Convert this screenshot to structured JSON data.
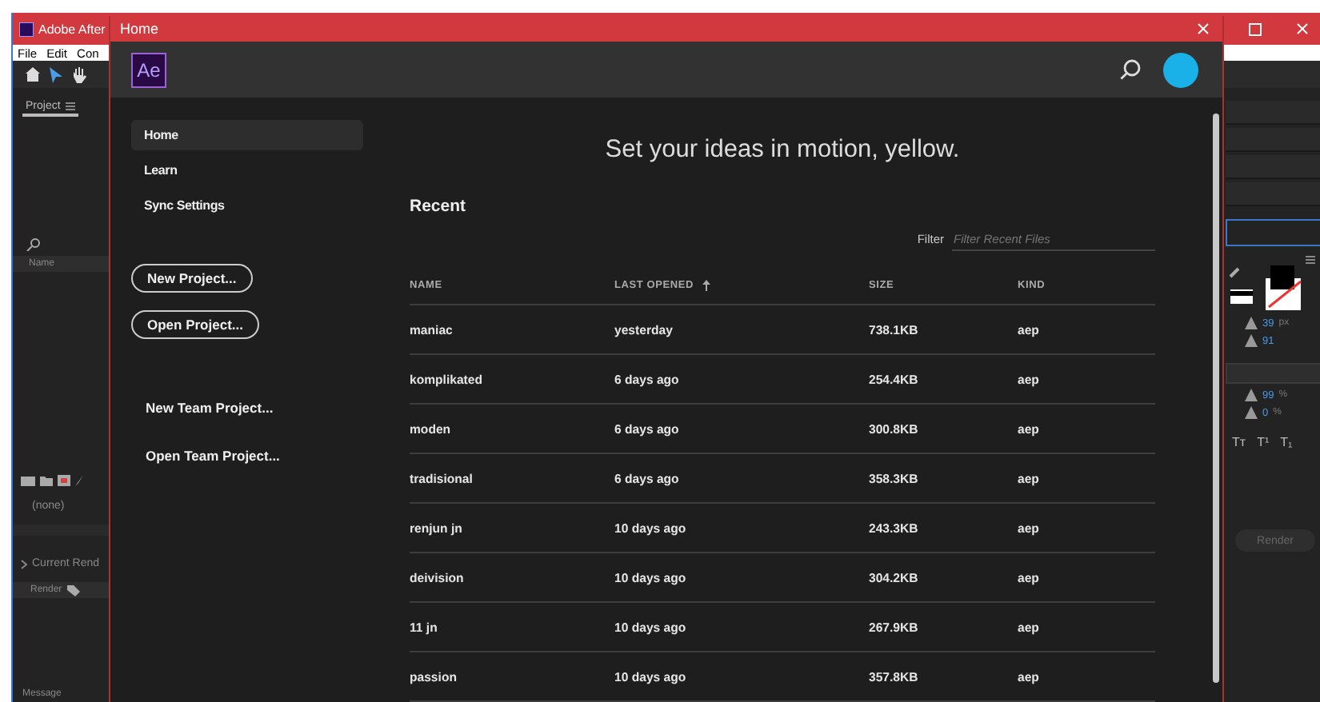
{
  "app": {
    "title": "Adobe After",
    "menu": [
      "File",
      "Edit",
      "Con"
    ],
    "project_tab": "Project",
    "project_column": "Name",
    "render_value": "(none)",
    "current_render": "Current Rend",
    "render_tab": "Render",
    "message": "Message",
    "character_panel": {
      "font_size": "39",
      "font_size_unit": "px",
      "leading": "91",
      "scale": "99",
      "scale_unit": "%",
      "baseline": "0",
      "baseline_unit": "%",
      "styles": [
        "Tт",
        "T¹",
        "T₁"
      ]
    },
    "render_button": "Render"
  },
  "dialog": {
    "title": "Home",
    "logo": "Ae",
    "nav": [
      {
        "label": "Home",
        "selected": true
      },
      {
        "label": "Learn",
        "selected": false
      },
      {
        "label": "Sync Settings",
        "selected": false
      }
    ],
    "buttons": [
      "New Project...",
      "Open Project..."
    ],
    "team_links": [
      "New Team Project...",
      "Open Team Project..."
    ],
    "headline": "Set your ideas in motion, yellow.",
    "recent_title": "Recent",
    "filter": {
      "label": "Filter",
      "placeholder": "Filter Recent Files"
    },
    "columns": [
      {
        "label": "NAME",
        "sorted": false
      },
      {
        "label": "LAST OPENED",
        "sorted": true
      },
      {
        "label": "SIZE",
        "sorted": false
      },
      {
        "label": "KIND",
        "sorted": false
      }
    ],
    "rows": [
      [
        "maniac",
        "yesterday",
        "738.1KB",
        "aep"
      ],
      [
        "komplikated",
        "6 days ago",
        "254.4KB",
        "aep"
      ],
      [
        "moden",
        "6 days ago",
        "300.8KB",
        "aep"
      ],
      [
        "tradisional",
        "6 days ago",
        "358.3KB",
        "aep"
      ],
      [
        "renjun jn",
        "10 days ago",
        "243.3KB",
        "aep"
      ],
      [
        "deivision",
        "10 days ago",
        "304.2KB",
        "aep"
      ],
      [
        "11 jn",
        "10 days ago",
        "267.9KB",
        "aep"
      ],
      [
        "passion",
        "10 days ago",
        "357.8KB",
        "aep"
      ]
    ]
  }
}
